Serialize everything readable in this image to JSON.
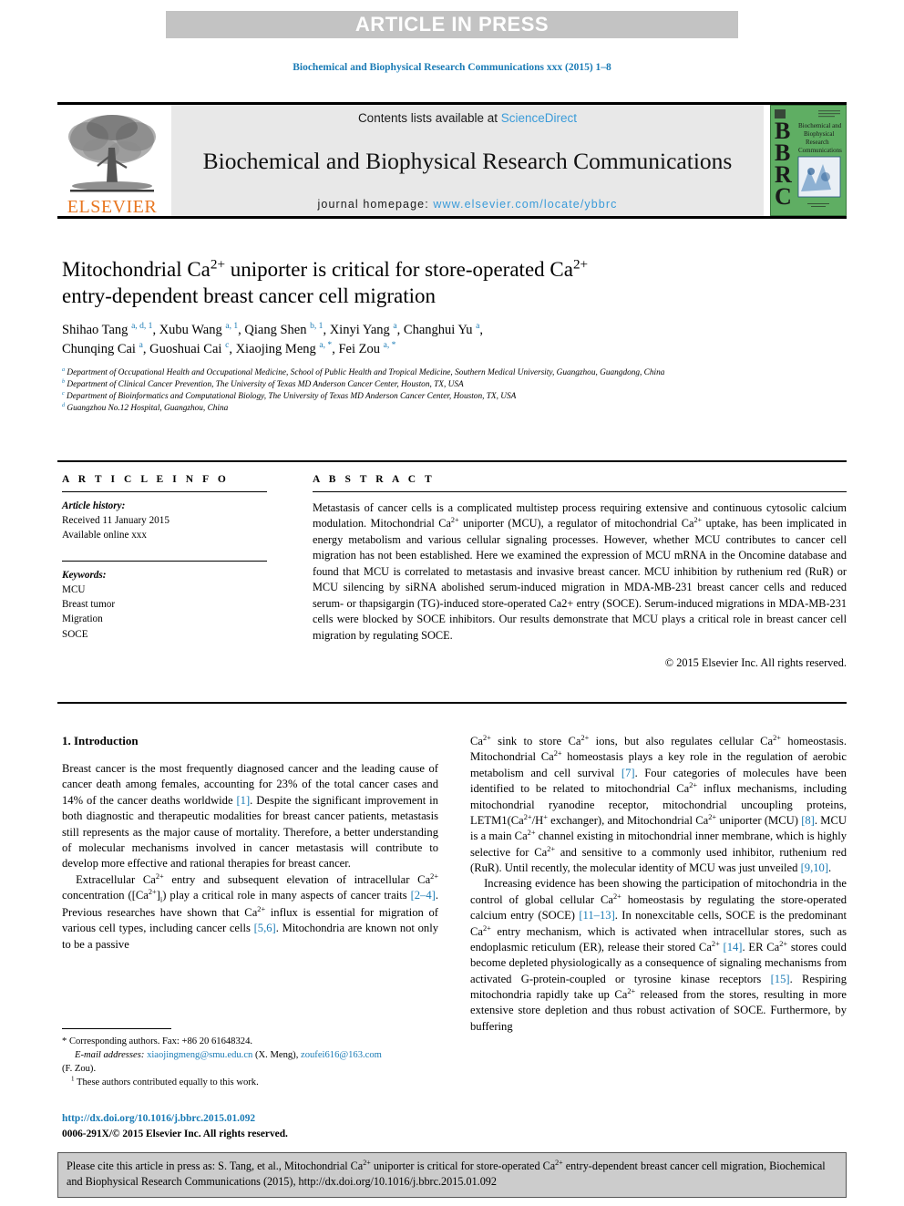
{
  "banner": {
    "label": "ARTICLE IN PRESS",
    "bg_color": "#c3c3c3",
    "text_color": "#ffffff"
  },
  "running_head": "Biochemical and Biophysical Research Communications xxx (2015) 1–8",
  "masthead": {
    "publisher_name": "ELSEVIER",
    "publisher_color": "#e87722",
    "contents_prefix": "Contents lists available at ",
    "contents_link": "ScienceDirect",
    "journal_title": "Biochemical and Biophysical Research Communications",
    "homepage_prefix": "journal homepage: ",
    "homepage_url": "www.elsevier.com/locate/ybbrc",
    "link_color": "#3a9bd9",
    "cover": {
      "letters": [
        "B",
        "B",
        "R",
        "C"
      ],
      "title_lines": [
        "Biochemical and",
        "Biophysical",
        "Research",
        "Communications"
      ],
      "bg_color": "#5fae63"
    }
  },
  "article": {
    "title_line1": "Mitochondrial Ca",
    "title_sup1": "2+",
    "title_line1b": " uniporter is critical for store-operated Ca",
    "title_sup2": "2+",
    "title_line2": "entry-dependent breast cancer cell migration",
    "authors": [
      {
        "name": "Shihao Tang",
        "marks": "a, d, 1"
      },
      {
        "name": "Xubu Wang",
        "marks": "a, 1"
      },
      {
        "name": "Qiang Shen",
        "marks": "b, 1"
      },
      {
        "name": "Xinyi Yang",
        "marks": "a"
      },
      {
        "name": "Changhui Yu",
        "marks": "a"
      },
      {
        "name": "Chunqing Cai",
        "marks": "a"
      },
      {
        "name": "Guoshuai Cai",
        "marks": "c"
      },
      {
        "name": "Xiaojing Meng",
        "marks": "a, *"
      },
      {
        "name": "Fei Zou",
        "marks": "a, *"
      }
    ],
    "affiliations": [
      {
        "mark": "a",
        "text": "Department of Occupational Health and Occupational Medicine, School of Public Health and Tropical Medicine, Southern Medical University, Guangzhou, Guangdong, China"
      },
      {
        "mark": "b",
        "text": "Department of Clinical Cancer Prevention, The University of Texas MD Anderson Cancer Center, Houston, TX, USA"
      },
      {
        "mark": "c",
        "text": "Department of Bioinformatics and Computational Biology, The University of Texas MD Anderson Cancer Center, Houston, TX, USA"
      },
      {
        "mark": "d",
        "text": "Guangzhou No.12 Hospital, Guangzhou, China"
      }
    ]
  },
  "article_info": {
    "heading": "A R T I C L E    I N F O",
    "history_label": "Article history:",
    "history": [
      "Received 11 January 2015",
      "Available online xxx"
    ],
    "keywords_label": "Keywords:",
    "keywords": [
      "MCU",
      "Breast tumor",
      "Migration",
      "SOCE"
    ]
  },
  "abstract": {
    "heading": "A B S T R A C T",
    "paragraph_1": "Metastasis of cancer cells is a complicated multistep process requiring extensive and continuous cytosolic calcium modulation. Mitochondrial Ca",
    "paragraph_2": " uniporter (MCU), a regulator of mitochondrial Ca",
    "paragraph_3": " uptake, has been implicated in energy metabolism and various cellular signaling processes. However, whether MCU contributes to cancer cell migration has not been established. Here we examined the expression of MCU mRNA in the Oncomine database and found that MCU is correlated to metastasis and invasive breast cancer. MCU inhibition by ruthenium red (RuR) or MCU silencing by siRNA abolished serum-induced migration in MDA-MB-231 breast cancer cells and reduced serum- or thapsigargin (TG)-induced store-operated Ca2+ entry (SOCE). Serum-induced migrations in MDA-MB-231 cells were blocked by SOCE inhibitors. Our results demonstrate that MCU plays a critical role in breast cancer cell migration by regulating SOCE.",
    "copyright": "© 2015 Elsevier Inc. All rights reserved."
  },
  "introduction": {
    "heading": "1.  Introduction",
    "left_paragraph_1_a": "Breast cancer is the most frequently diagnosed cancer and the leading cause of cancer death among females, accounting for 23% of the total cancer cases and 14% of the cancer deaths worldwide ",
    "left_ref_1": "[1]",
    "left_paragraph_1_b": ". Despite the significant improvement in both diagnostic and therapeutic modalities for breast cancer patients, metastasis still represents as the major cause of mortality. Therefore, a better understanding of molecular mechanisms involved in cancer metastasis will contribute to develop more effective and rational therapies for breast cancer.",
    "left_paragraph_2_a": "Extracellular Ca",
    "left_paragraph_2_b": " entry and subsequent elevation of intracellular Ca",
    "left_paragraph_2_c": " concentration ([Ca",
    "left_paragraph_2_d": "]",
    "left_paragraph_2_e": ") play a critical role in many aspects of cancer traits ",
    "left_ref_2": "[2–4]",
    "left_paragraph_2_f": ". Previous researches have shown that Ca",
    "left_paragraph_2_g": " influx is essential for migration of various cell types, including cancer cells ",
    "left_ref_3": "[5,6]",
    "left_paragraph_2_h": ". Mitochondria are known not only to be a passive",
    "right_paragraph_1_a": " sink to store Ca",
    "right_paragraph_1_b": " ions, but also regulates cellular Ca",
    "right_paragraph_1_c": " homeostasis. Mitochondrial Ca",
    "right_paragraph_1_d": " homeostasis plays a key role in the regulation of aerobic metabolism and cell survival ",
    "right_ref_7": "[7]",
    "right_paragraph_1_e": ". Four categories of molecules have been identified to be related to mitochondrial Ca",
    "right_paragraph_1_f": " influx mechanisms, including mitochondrial ryanodine receptor, mitochondrial uncoupling proteins, LETM1(Ca",
    "right_paragraph_1_g": "/H",
    "right_paragraph_1_h": " exchanger), and Mitochondrial Ca",
    "right_paragraph_1_i": " uniporter (MCU) ",
    "right_ref_8": "[8]",
    "right_paragraph_1_j": ". MCU is a main Ca",
    "right_paragraph_1_k": " channel existing in mitochondrial inner membrane, which is highly selective for Ca",
    "right_paragraph_1_l": " and sensitive to a commonly used inhibitor, ruthenium red (RuR). Until recently, the molecular identity of MCU was just unveiled ",
    "right_ref_910": "[9,10]",
    "right_paragraph_1_m": ".",
    "right_paragraph_2_a": "Increasing evidence has been showing the participation of mitochondria in the control of global cellular Ca",
    "right_paragraph_2_b": " homeostasis by regulating the store-operated calcium entry (SOCE) ",
    "right_ref_1113": "[11–13]",
    "right_paragraph_2_c": ". In nonexcitable cells, SOCE is the predominant Ca",
    "right_paragraph_2_d": " entry mechanism, which is activated when intracellular stores, such as endoplasmic reticulum (ER), release their stored Ca",
    "right_ref_14": "[14]",
    "right_paragraph_2_e": ". ER Ca",
    "right_paragraph_2_f": " stores could become depleted physiologically as a consequence of signaling mechanisms from activated G-protein-coupled or tyrosine kinase receptors ",
    "right_ref_15": "[15]",
    "right_paragraph_2_g": ". Respiring mitochondria rapidly take up Ca",
    "right_paragraph_2_h": " released from the stores, resulting in more extensive store depletion and thus robust activation of SOCE. Furthermore, by buffering"
  },
  "footnotes": {
    "corresponding": "* Corresponding authors. Fax: +86 20 61648324.",
    "email_label": "E-mail addresses:",
    "email_1": "xiaojingmeng@smu.edu.cn",
    "email_1_owner": "(X. Meng),",
    "email_2": "zoufei616@163.com",
    "email_2_owner": "(F. Zou).",
    "equal_contribution": "These authors contributed equally to this work.",
    "equal_mark": "1"
  },
  "doi_block": {
    "doi_url": "http://dx.doi.org/10.1016/j.bbrc.2015.01.092",
    "issn_line": "0006-291X/© 2015 Elsevier Inc. All rights reserved."
  },
  "citation_footer": {
    "line1_a": "Please cite this article in press as: S. Tang, et al., Mitochondrial Ca",
    "line1_b": " uniporter is critical for store-operated Ca",
    "line1_c": " entry-dependent breast cancer",
    "line2": "cell migration, Biochemical and Biophysical Research Communications (2015), http://dx.doi.org/10.1016/j.bbrc.2015.01.092"
  },
  "symbols": {
    "ca_charge": "2+",
    "h_charge": "+",
    "subscript_i": "i"
  }
}
